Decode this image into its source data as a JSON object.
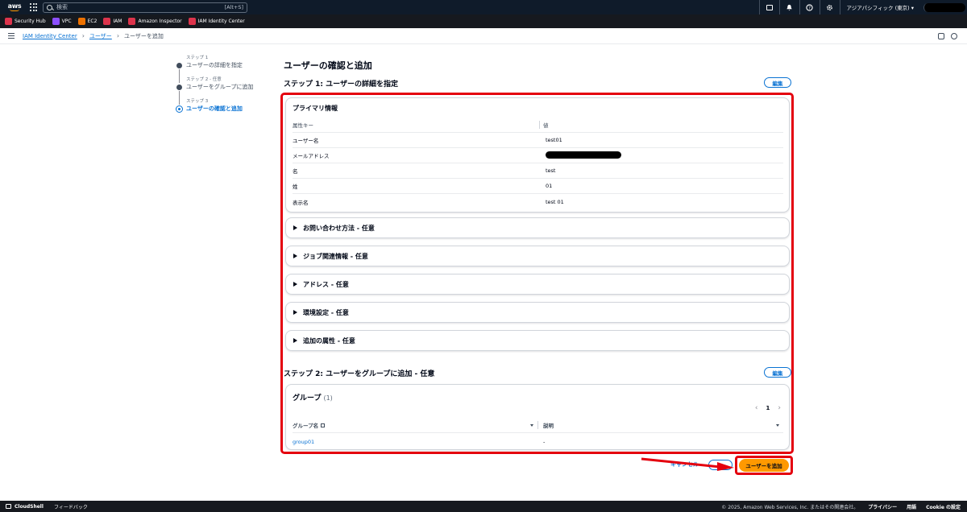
{
  "topnav": {
    "logo_text": "aws",
    "search_placeholder": "検索",
    "search_shortcut": "[Alt+S]",
    "region": "アジアパシフィック (東京) ▾"
  },
  "favorites": [
    {
      "label": "Security Hub",
      "color": "#dd344c"
    },
    {
      "label": "VPC",
      "color": "#8c4fff"
    },
    {
      "label": "EC2",
      "color": "#ed7100"
    },
    {
      "label": "IAM",
      "color": "#dd344c"
    },
    {
      "label": "Amazon Inspector",
      "color": "#dd344c"
    },
    {
      "label": "IAM Identity Center",
      "color": "#dd344c"
    }
  ],
  "breadcrumb": {
    "root": "IAM Identity Center",
    "users": "ユーザー",
    "current": "ユーザーを追加"
  },
  "steps": [
    {
      "small": "ステップ 1",
      "title": "ユーザーの詳細を指定"
    },
    {
      "small": "ステップ 2 - 任意",
      "title": "ユーザーをグループに追加"
    },
    {
      "small": "ステップ 3",
      "title": "ユーザーの確認と追加"
    }
  ],
  "main": {
    "title": "ユーザーの確認と追加",
    "step1_title": "ステップ 1: ユーザーの詳細を指定",
    "step2_title": "ステップ 2: ユーザーをグループに追加 - 任意",
    "edit_label": "編集"
  },
  "primary_info": {
    "title": "プライマリ情報",
    "col_key": "属性キー",
    "col_value": "値",
    "rows": [
      {
        "key": "ユーザー名",
        "value": "test01"
      },
      {
        "key": "メールアドレス",
        "value": ""
      },
      {
        "key": "名",
        "value": "test"
      },
      {
        "key": "姓",
        "value": "01"
      },
      {
        "key": "表示名",
        "value": "test 01"
      }
    ]
  },
  "expandables": [
    "お問い合わせ方法 - 任意",
    "ジョブ関連情報 - 任意",
    "アドレス - 任意",
    "環境設定 - 任意",
    "追加の属性 - 任意"
  ],
  "groups": {
    "title": "グループ",
    "count": "(1)",
    "page": "1",
    "col_name": "グループ名",
    "col_desc": "説明",
    "rows": [
      {
        "name": "group01",
        "desc": "-"
      }
    ]
  },
  "actions": {
    "cancel": "キャンセル",
    "submit": "ユーザーを追加"
  },
  "footer": {
    "cloudshell": "CloudShell",
    "feedback": "フィードバック",
    "copyright": "© 2025, Amazon Web Services, Inc. またはその関連会社。",
    "privacy": "プライバシー",
    "terms": "用語",
    "cookie": "Cookie の設定"
  },
  "colors": {
    "highlight": "#e4000e",
    "primary_button": "#ff9900",
    "link": "#0972d3"
  }
}
